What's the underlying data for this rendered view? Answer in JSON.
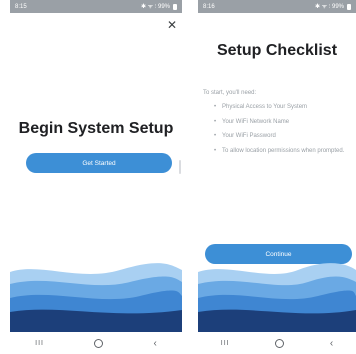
{
  "left_screen": {
    "status": {
      "time": "8:15",
      "icons": "✱ ᯤ ⫶ 99%"
    },
    "title": "Begin System Setup",
    "button_label": "Get Started"
  },
  "right_screen": {
    "status": {
      "time": "8:16",
      "icons": "✱ ᯤ ⫶ 99%"
    },
    "title": "Setup Checklist",
    "intro": "To start, you'll need:",
    "items": [
      "Physical Access to Your System",
      "Your WiFi Network Name",
      "Your WiFi Password",
      "To allow location permissions when prompted."
    ],
    "button_label": "Continue"
  },
  "nav": {
    "recent": "III",
    "back": "‹"
  },
  "colors": {
    "accent": "#3d8fd6",
    "wave_dark": "#1c3f7a",
    "wave_light": "#4c93d8",
    "status_bar": "#9aa0a6"
  }
}
